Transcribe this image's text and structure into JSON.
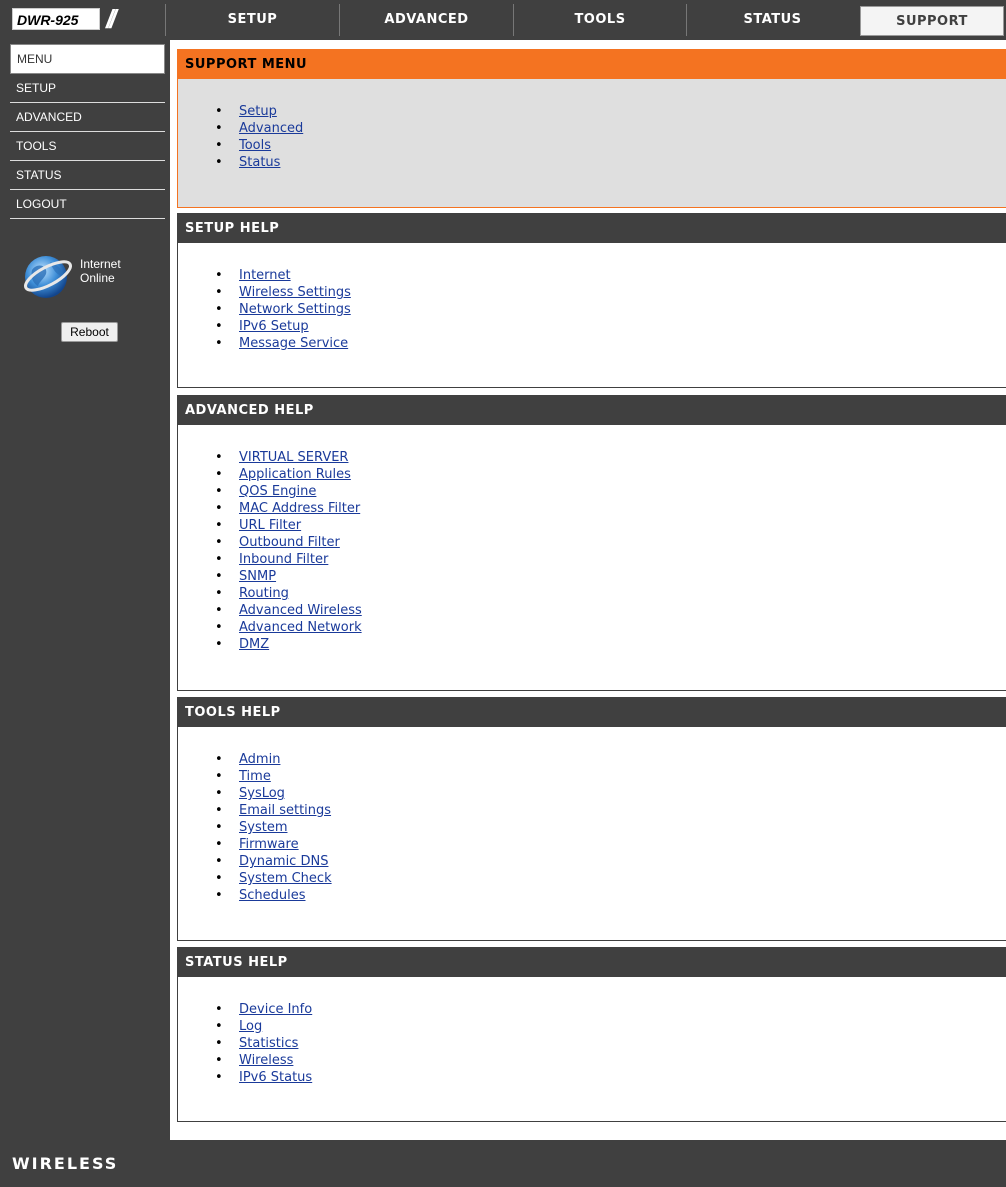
{
  "header": {
    "model": "DWR-925",
    "tabs": [
      {
        "label": "SETUP",
        "active": false
      },
      {
        "label": "ADVANCED",
        "active": false
      },
      {
        "label": "TOOLS",
        "active": false
      },
      {
        "label": "STATUS",
        "active": false
      },
      {
        "label": "SUPPORT",
        "active": true
      }
    ]
  },
  "sidebar": {
    "menu_label": "MENU",
    "items": [
      "SETUP",
      "ADVANCED",
      "TOOLS",
      "STATUS",
      "LOGOUT"
    ],
    "status_line1": "Internet",
    "status_line2": "Online",
    "reboot_label": "Reboot",
    "status_icon": "internet-globe-icon"
  },
  "sections": {
    "support_menu": {
      "title": "SUPPORT MENU",
      "links": [
        "Setup",
        "Advanced",
        "Tools",
        "Status"
      ]
    },
    "setup_help": {
      "title": "SETUP HELP",
      "links": [
        "Internet",
        "Wireless Settings",
        "Network Settings",
        "IPv6 Setup",
        "Message Service"
      ]
    },
    "advanced_help": {
      "title": "ADVANCED HELP",
      "links": [
        "VIRTUAL SERVER",
        "Application Rules",
        "QOS Engine",
        "MAC Address Filter",
        "URL Filter",
        "Outbound Filter",
        "Inbound Filter",
        "SNMP",
        "Routing",
        "Advanced Wireless",
        "Advanced Network",
        "DMZ"
      ]
    },
    "tools_help": {
      "title": "TOOLS HELP",
      "links": [
        "Admin",
        "Time",
        "SysLog",
        "Email settings",
        "System",
        "Firmware",
        "Dynamic DNS",
        "System Check",
        "Schedules"
      ]
    },
    "status_help": {
      "title": "STATUS HELP",
      "links": [
        "Device Info",
        "Log",
        "Statistics",
        "Wireless",
        "IPv6 Status"
      ]
    }
  },
  "footer": {
    "brand": "WIRELESS"
  },
  "colors": {
    "header_bg": "#404040",
    "accent_orange": "#f47321",
    "link": "#1a3a9a"
  }
}
